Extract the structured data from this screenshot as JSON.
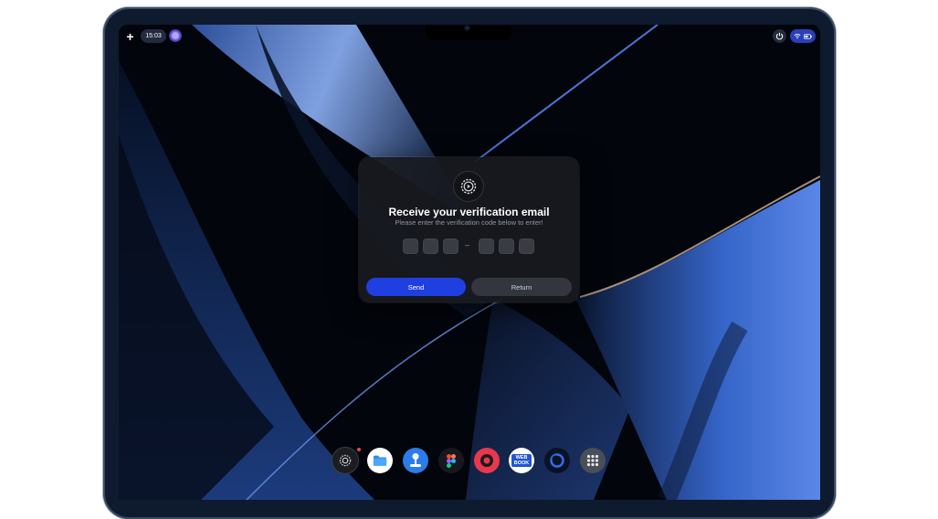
{
  "topbar": {
    "plus_label": "+",
    "time": "15:03"
  },
  "dialog": {
    "title": "Receive your verification email",
    "subtitle": "Please enter the verification code below to enter!",
    "code_separator": "–",
    "send_label": "Send",
    "return_label": "Return"
  },
  "dock": {
    "items": [
      "settings-icon",
      "files-icon",
      "joystick-icon",
      "figma-icon",
      "record-icon",
      "web-book-icon",
      "ring-icon",
      "app-grid-icon"
    ],
    "webbook_text": "WEB BOOK"
  },
  "colors": {
    "send_button": "#1f3fe0",
    "status_pill": "#2b3fb8",
    "notification_dot": "#e64646"
  }
}
